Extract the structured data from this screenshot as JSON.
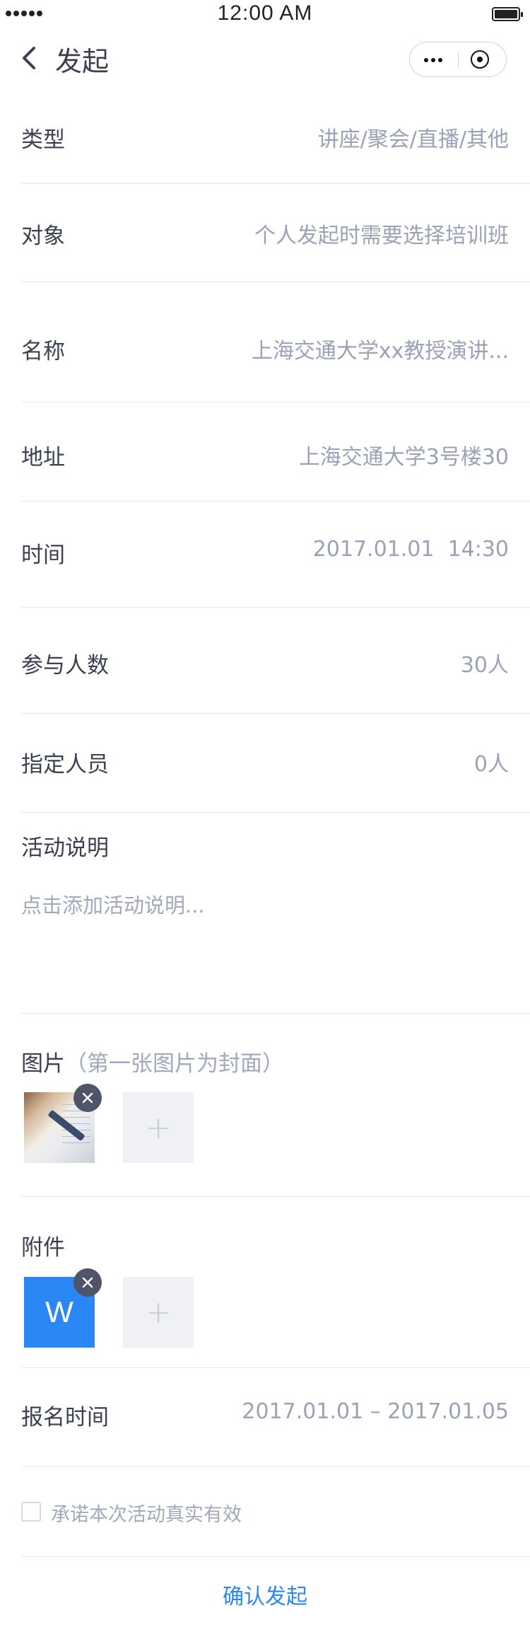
{
  "status_bar": {
    "time": "12:00 AM"
  },
  "nav": {
    "title": "发起",
    "back_icon": "chevron-left-icon",
    "more_icon": "more-dots-icon",
    "close_icon": "target-icon"
  },
  "form": {
    "type": {
      "label": "类型",
      "value": "讲座/聚会/直播/其他"
    },
    "audience": {
      "label": "对象",
      "value": "个人发起时需要选择培训班"
    },
    "name": {
      "label": "名称",
      "value": "上海交通大学xx教授演讲..."
    },
    "address": {
      "label": "地址",
      "value": "上海交通大学3号楼30"
    },
    "time": {
      "label": "时间",
      "value": "2017.01.01  14:30"
    },
    "participants": {
      "label": "参与人数",
      "value": "30人"
    },
    "assigned": {
      "label": "指定人员",
      "value": "0人"
    },
    "description": {
      "label": "活动说明",
      "placeholder": "点击添加活动说明..."
    },
    "images": {
      "label": "图片",
      "hint": "（第一张图片为封面）",
      "add_symbol": "+"
    },
    "attachments": {
      "label": "附件",
      "file_letter": "W",
      "add_symbol": "+"
    },
    "signup_time": {
      "label": "报名时间",
      "value": "2017.01.01 – 2017.01.05"
    },
    "promise": {
      "label": "承诺本次活动真实有效",
      "checked": false
    }
  },
  "actions": {
    "confirm_label": "确认发起"
  },
  "colors": {
    "accent": "#2b86f6",
    "label": "#3c4152",
    "value": "#9ba2b8",
    "divider": "#e7e9ee"
  }
}
